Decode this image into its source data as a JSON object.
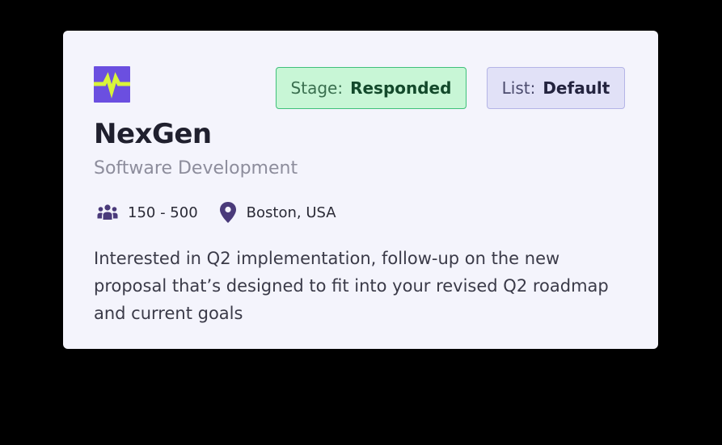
{
  "card": {
    "logo_icon": "pulse-wave-logo-icon",
    "stage_label": "Stage:",
    "stage_value": "Responded",
    "list_label": "List:",
    "list_value": "Default",
    "company_name": "NexGen",
    "industry": "Software Development",
    "employee_range": "150 - 500",
    "employees_icon": "people-group-icon",
    "location": "Boston, USA",
    "location_icon": "map-pin-icon",
    "description": "Interested in Q2 implementation, follow-up on the new proposal that’s designed to fit into your revised Q2 roadmap and current goals"
  },
  "colors": {
    "logo_bg": "#6b4fe0",
    "logo_wave": "#d9f43a",
    "stage_bg": "#c8f6d6",
    "stage_border": "#3fc07a",
    "list_bg": "#e1e1f7",
    "list_border": "#b4b4e6",
    "icon_color": "#4a3a7a"
  }
}
